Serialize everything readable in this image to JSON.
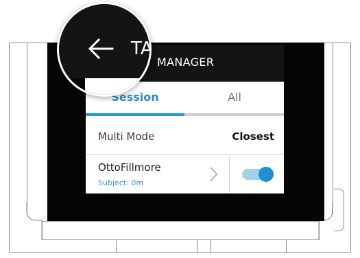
{
  "screen": {
    "header": {
      "title_visible": "MANAGER",
      "back_icon": "arrow-left-icon"
    },
    "tabs": [
      {
        "label": "Session",
        "active": true
      },
      {
        "label": "All",
        "active": false
      }
    ],
    "multi_mode": {
      "label": "Multi Mode",
      "value": "Closest"
    },
    "subject": {
      "name": "OttoFillmore",
      "detail": "Subject: 0m",
      "chevron_icon": "chevron-right-icon",
      "toggle_on": true
    }
  },
  "magnifier": {
    "title_fragment": "TA",
    "back_glyph": "←"
  },
  "colors": {
    "accent": "#2b9ad0",
    "header_bg": "#141414",
    "bezel": "#050505"
  }
}
